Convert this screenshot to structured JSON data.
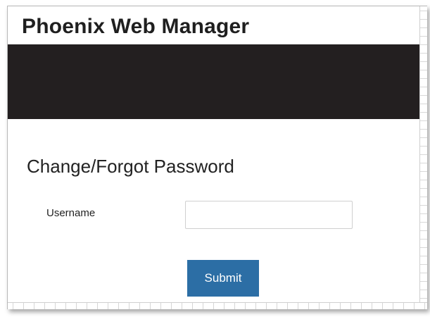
{
  "app": {
    "title": "Phoenix Web Manager"
  },
  "page": {
    "heading": "Change/Forgot Password"
  },
  "form": {
    "username_label": "Username",
    "username_value": "",
    "username_placeholder": "",
    "submit_label": "Submit"
  },
  "colors": {
    "banner": "#231f20",
    "submit_button": "#2c6ea5",
    "title_text": "#1f1f1f"
  }
}
